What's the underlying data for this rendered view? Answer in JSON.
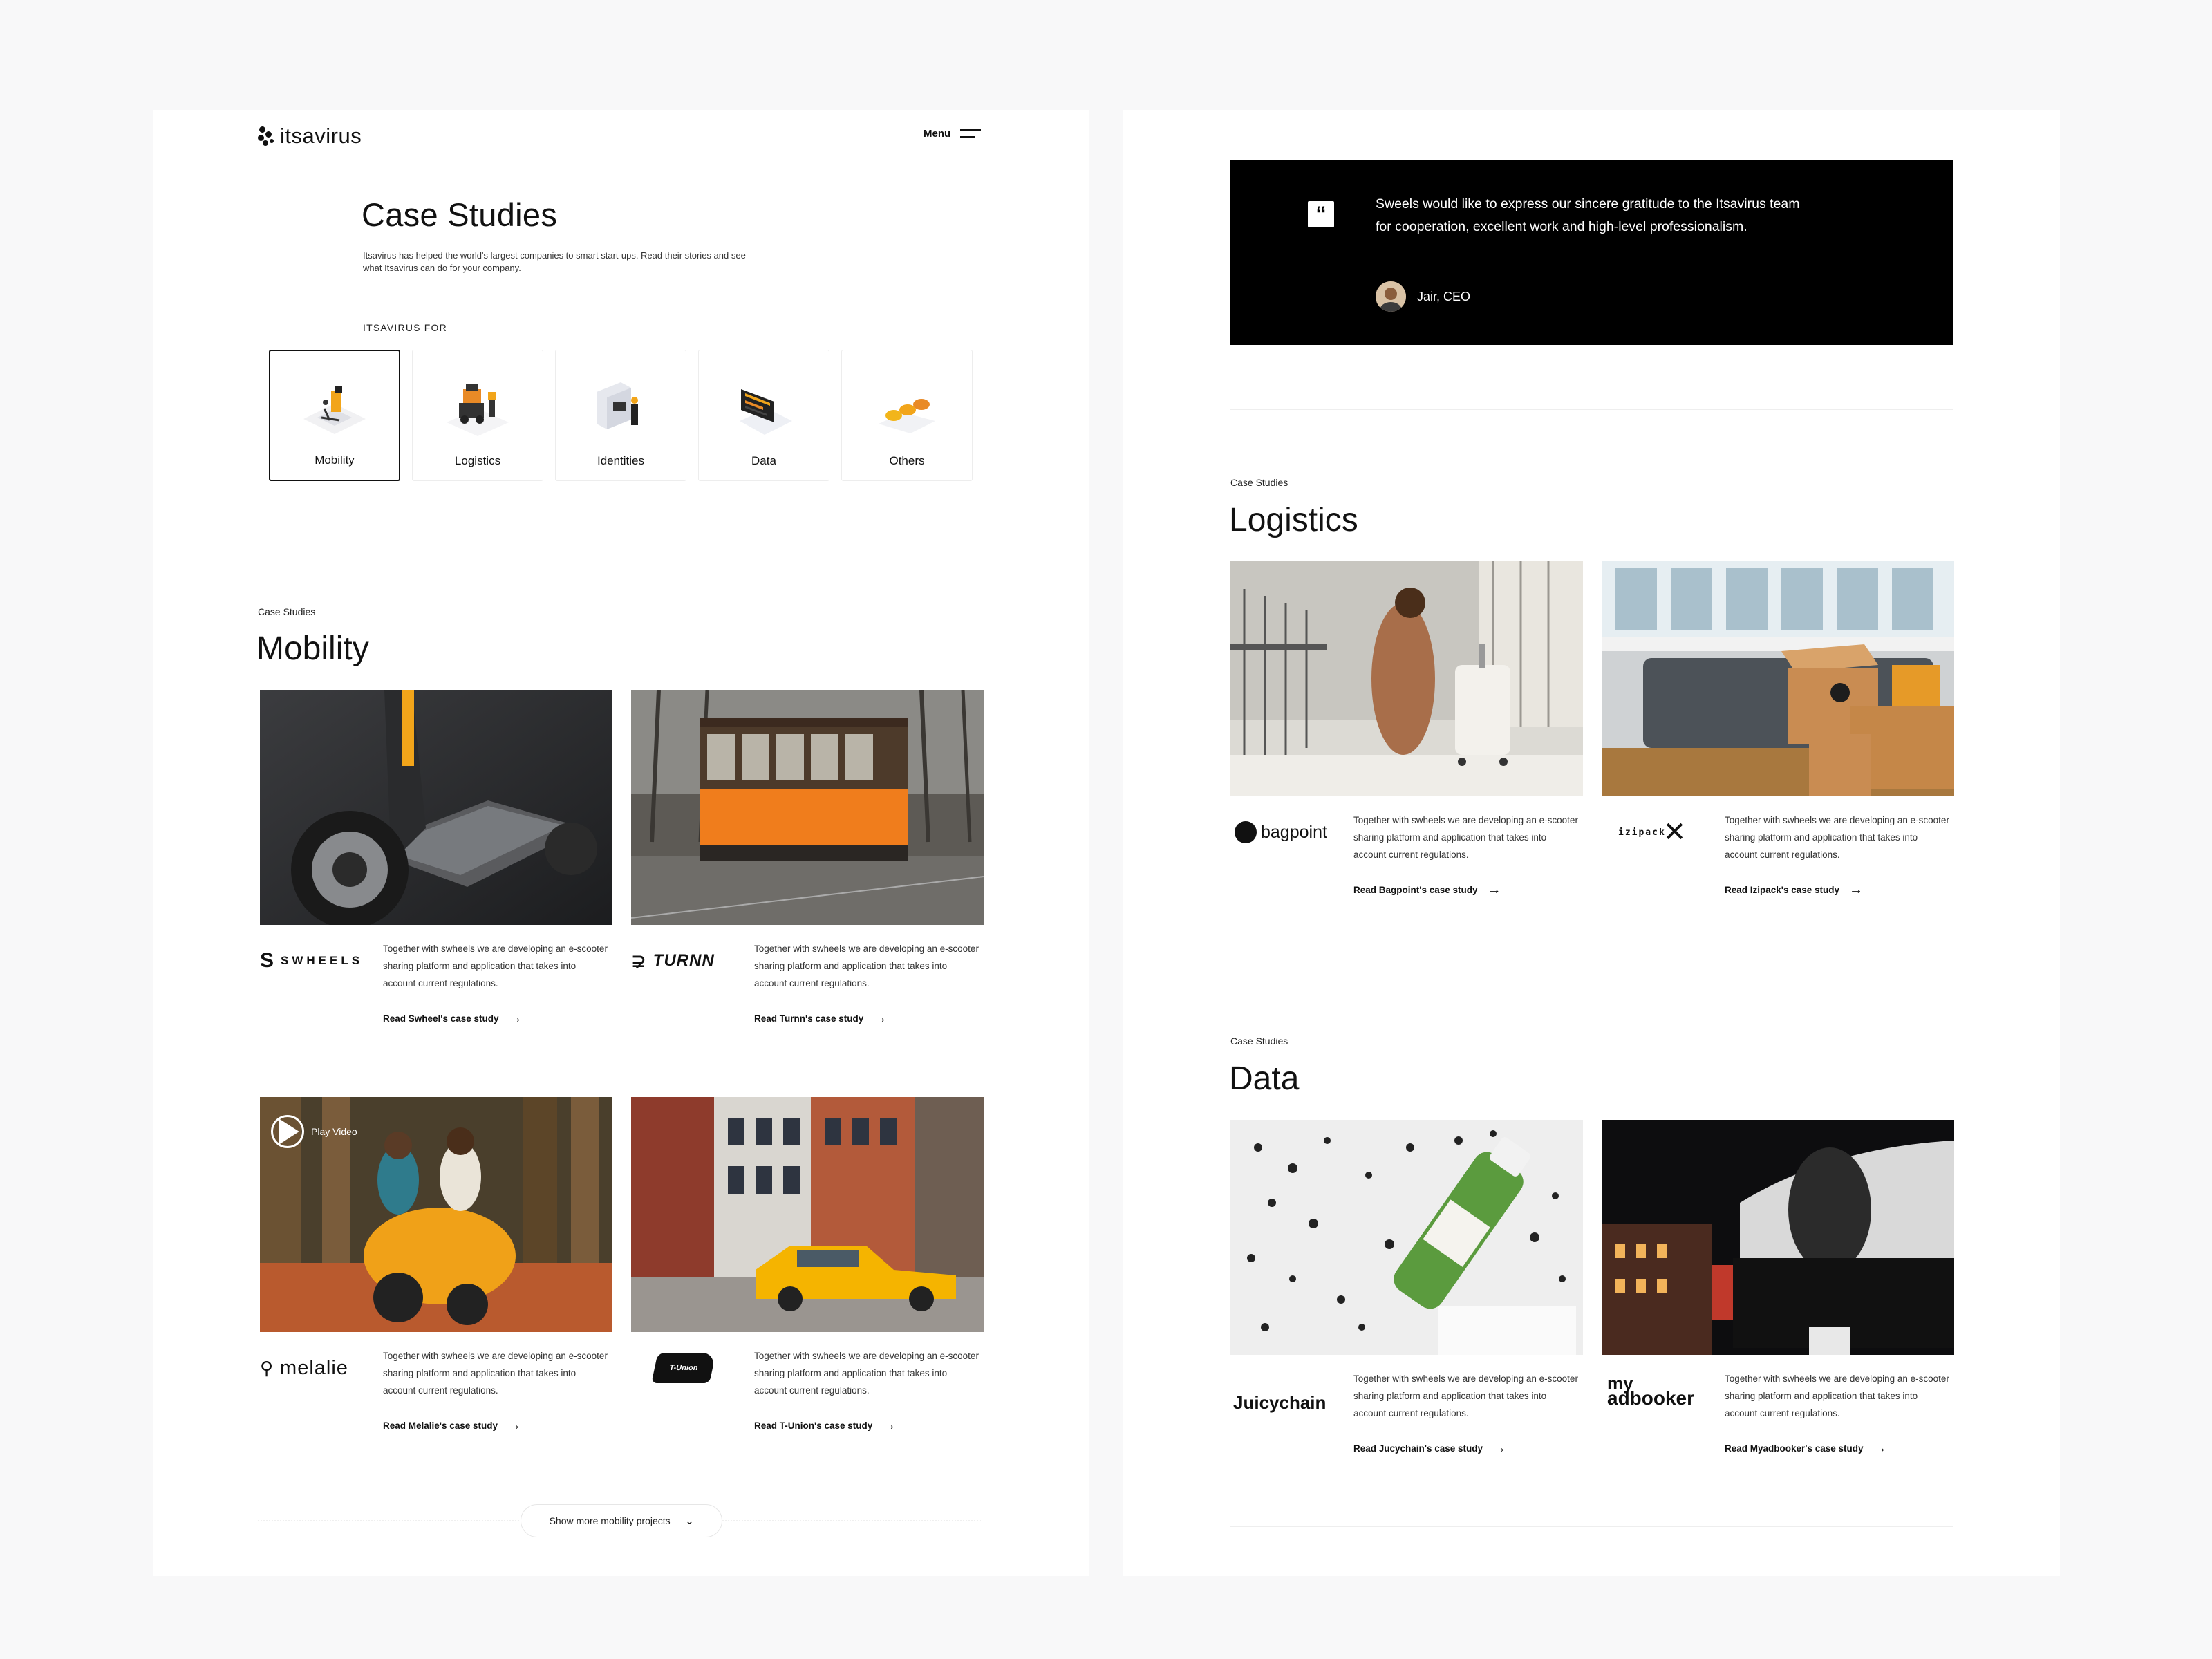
{
  "left": {
    "logo_text": "itsavirus",
    "menu_label": "Menu",
    "hero": {
      "title": "Case Studies",
      "intro": "Itsavirus has helped the world's largest companies to smart start-ups. Read their stories and see what Itsavirus can do for your company."
    },
    "categories_label": "ITSAVIRUS FOR",
    "categories": [
      {
        "label": "Mobility",
        "active": true
      },
      {
        "label": "Logistics",
        "active": false
      },
      {
        "label": "Identities",
        "active": false
      },
      {
        "label": "Data",
        "active": false
      },
      {
        "label": "Others",
        "active": false
      }
    ],
    "mobility": {
      "eyebrow": "Case Studies",
      "title": "Mobility",
      "cards": [
        {
          "brand": "SWHEELS",
          "description": "Together with swheels we are developing an e-scooter sharing platform and application that takes into account current regulations.",
          "link": "Read Swheel's case study"
        },
        {
          "brand": "TURNN",
          "description": "Together with swheels we are developing an e-scooter sharing platform and application that takes into account current regulations.",
          "link": "Read Turnn's case study"
        },
        {
          "brand": "melalie",
          "description": "Together with swheels we are developing an e-scooter sharing platform and application that takes into account current regulations.",
          "link": "Read Melalie's case study",
          "play_label": "Play Video"
        },
        {
          "brand": "T-Union",
          "description": "Together with swheels we are developing an e-scooter sharing platform and application that takes into account current regulations.",
          "link": "Read T-Union's case study"
        }
      ],
      "show_more": "Show more mobility projects"
    }
  },
  "right": {
    "testimonial": {
      "text": "Sweels would like to express our sincere gratitude to the Itsavirus team for cooperation, excellent work and high-level professionalism.",
      "author": "Jair, CEO"
    },
    "logistics": {
      "eyebrow": "Case Studies",
      "title": "Logistics",
      "cards": [
        {
          "brand": "bagpoint",
          "description": "Together with swheels we are developing an e-scooter sharing platform and application that takes into account current regulations.",
          "link": "Read Bagpoint's case study"
        },
        {
          "brand": "izipack",
          "description": "Together with swheels we are developing an e-scooter sharing platform and application that takes into account current regulations.",
          "link": "Read Izipack's case study"
        }
      ]
    },
    "data": {
      "eyebrow": "Case Studies",
      "title": "Data",
      "cards": [
        {
          "brand": "Juicychain",
          "description": "Together with swheels we are developing an e-scooter sharing platform and application that takes into account current regulations.",
          "link": "Read Jucychain's case study"
        },
        {
          "brand_line1": "my",
          "brand_line2": "adbooker",
          "description": "Together with swheels we are developing an e-scooter sharing platform and application that takes into account current regulations.",
          "link": "Read Myadbooker's case study"
        }
      ]
    }
  }
}
